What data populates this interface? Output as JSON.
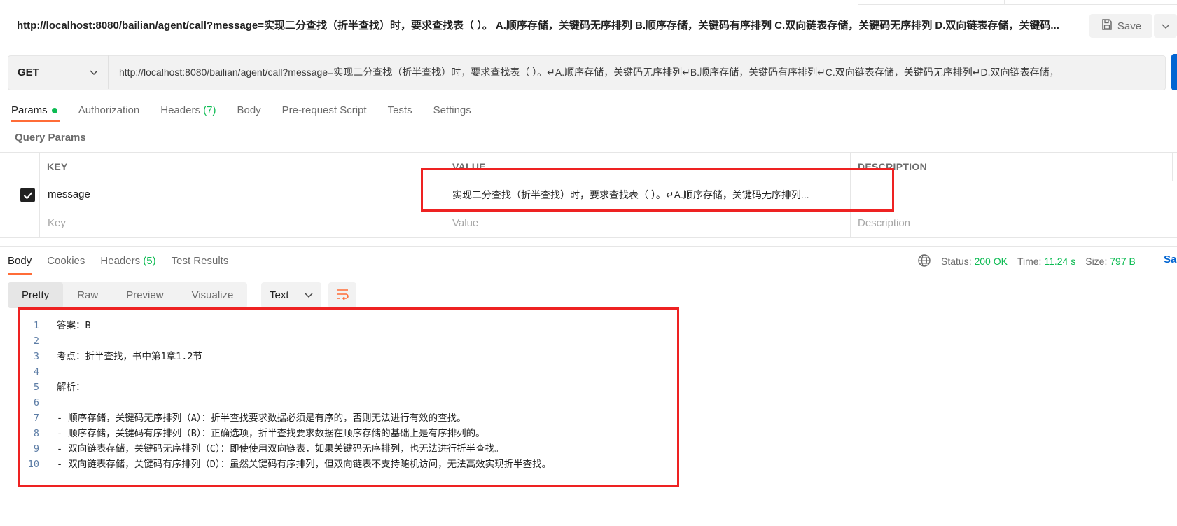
{
  "request": {
    "title": "http://localhost:8080/bailian/agent/call?message=实现二分查找（折半查找）时，要求查找表（ ）。 A.顺序存储，关键码无序排列 B.顺序存储，关键码有序排列 C.双向链表存储，关键码无序排列 D.双向链表存储，关键码...",
    "save_label": "Save",
    "method": "GET",
    "url": "http://localhost:8080/bailian/agent/call?message=实现二分查找（折半查找）时，要求查找表（ ）。↵A.顺序存储，关键码无序排列↵B.顺序存储，关键码有序排列↵C.双向链表存储，关键码无序排列↵D.双向链表存储，"
  },
  "request_tabs": [
    {
      "label": "Params",
      "badge": ""
    },
    {
      "label": "Authorization",
      "badge": ""
    },
    {
      "label": "Headers",
      "badge": "(7)"
    },
    {
      "label": "Body",
      "badge": ""
    },
    {
      "label": "Pre-request Script",
      "badge": ""
    },
    {
      "label": "Tests",
      "badge": ""
    },
    {
      "label": "Settings",
      "badge": ""
    }
  ],
  "query_params": {
    "title": "Query Params",
    "headers": {
      "key": "KEY",
      "value": "VALUE",
      "description": "DESCRIPTION"
    },
    "rows": [
      {
        "key": "message",
        "value": "实现二分查找（折半查找）时，要求查找表（ ）。↵A.顺序存储，关键码无序排列...",
        "description": "",
        "checked": true
      }
    ],
    "placeholders": {
      "key": "Key",
      "value": "Value",
      "description": "Description"
    }
  },
  "response": {
    "tabs": [
      {
        "label": "Body",
        "badge": ""
      },
      {
        "label": "Cookies",
        "badge": ""
      },
      {
        "label": "Headers",
        "badge": "(5)"
      },
      {
        "label": "Test Results",
        "badge": ""
      }
    ],
    "status_label": "Status:",
    "status_value": "200 OK",
    "time_label": "Time:",
    "time_value": "11.24 s",
    "size_label": "Size:",
    "size_value": "797 B",
    "save_label": "Sa",
    "view_modes": [
      "Pretty",
      "Raw",
      "Preview",
      "Visualize"
    ],
    "active_view": "Pretty",
    "format": "Text",
    "lines": [
      {
        "num": "1",
        "text": "答案：B"
      },
      {
        "num": "2",
        "text": ""
      },
      {
        "num": "3",
        "text": "考点：折半查找，书中第1章1.2节"
      },
      {
        "num": "4",
        "text": ""
      },
      {
        "num": "5",
        "text": "解析："
      },
      {
        "num": "6",
        "text": ""
      },
      {
        "num": "7",
        "text": "- 顺序存储，关键码无序排列（A）：折半查找要求数据必须是有序的，否则无法进行有效的查找。"
      },
      {
        "num": "8",
        "text": "- 顺序存储，关键码有序排列（B）：正确选项，折半查找要求数据在顺序存储的基础上是有序排列的。"
      },
      {
        "num": "9",
        "text": "- 双向链表存储，关键码无序排列（C）：即使使用双向链表，如果关键码无序排列，也无法进行折半查找。"
      },
      {
        "num": "10",
        "text": "- 双向链表存储，关键码有序排列（D）：虽然关键码有序排列，但双向链表不支持随机访问，无法高效实现折半查找。"
      }
    ]
  },
  "colors": {
    "accent": "#ff6c37",
    "success": "#0cbb52",
    "highlight": "#ee2222",
    "link": "#0265d2"
  }
}
